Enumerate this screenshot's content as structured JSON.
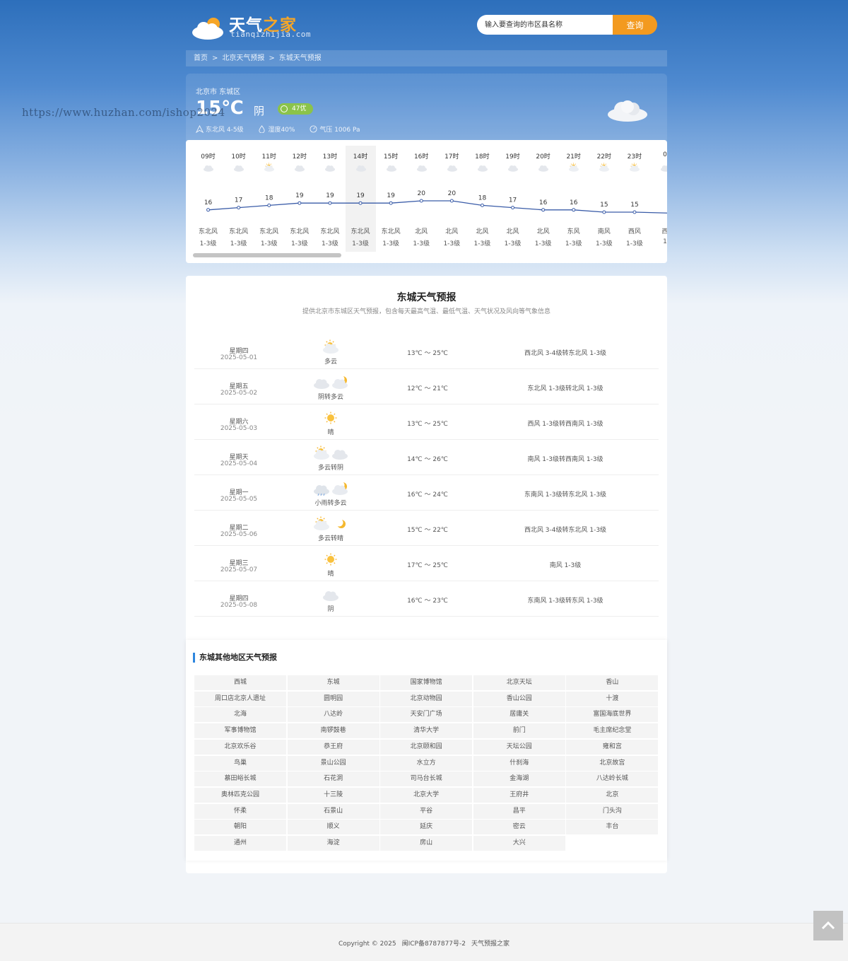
{
  "header": {
    "logo_title_a": "天气",
    "logo_title_b": "之家",
    "logo_sub": "tianqizhijia.com",
    "search_placeholder": "输入要查询的市区县名称",
    "search_button": "查询"
  },
  "breadcrumb": [
    "首页",
    "北京天气预报",
    "东城天气预报"
  ],
  "current": {
    "location": "北京市 东城区",
    "temp": "15℃",
    "desc": "阴",
    "aqi": "47优",
    "wind": "东北风 4-5级",
    "humidity": "湿度40%",
    "pressure": "气压 1006 Pa"
  },
  "watermark": "https://www.huzhan.com/ishop2024",
  "hourly": [
    {
      "time": "09时",
      "icon": "overcast",
      "temp": 16,
      "wind": "东北风",
      "level": "1-3级"
    },
    {
      "time": "10时",
      "icon": "overcast",
      "temp": 17,
      "wind": "东北风",
      "level": "1-3级"
    },
    {
      "time": "11时",
      "icon": "partly-cloudy",
      "temp": 18,
      "wind": "东北风",
      "level": "1-3级"
    },
    {
      "time": "12时",
      "icon": "overcast",
      "temp": 19,
      "wind": "东北风",
      "level": "1-3级"
    },
    {
      "time": "13时",
      "icon": "overcast",
      "temp": 19,
      "wind": "东北风",
      "level": "1-3级"
    },
    {
      "time": "14时",
      "icon": "overcast",
      "temp": 19,
      "wind": "东北风",
      "level": "1-3级"
    },
    {
      "time": "15时",
      "icon": "overcast",
      "temp": 19,
      "wind": "东北风",
      "level": "1-3级"
    },
    {
      "time": "16时",
      "icon": "overcast",
      "temp": 20,
      "wind": "北风",
      "level": "1-3级"
    },
    {
      "time": "17时",
      "icon": "overcast",
      "temp": 20,
      "wind": "北风",
      "level": "1-3级"
    },
    {
      "time": "18时",
      "icon": "overcast",
      "temp": 18,
      "wind": "北风",
      "level": "1-3级"
    },
    {
      "time": "19时",
      "icon": "overcast",
      "temp": 17,
      "wind": "北风",
      "level": "1-3级"
    },
    {
      "time": "20时",
      "icon": "overcast",
      "temp": 16,
      "wind": "北风",
      "level": "1-3级"
    },
    {
      "time": "21时",
      "icon": "partly-cloudy",
      "temp": 16,
      "wind": "东风",
      "level": "1-3级"
    },
    {
      "time": "22时",
      "icon": "partly-cloudy",
      "temp": 15,
      "wind": "南风",
      "level": "1-3级"
    },
    {
      "time": "23时",
      "icon": "partly-cloudy",
      "temp": 15,
      "wind": "西风",
      "level": "1-3级"
    },
    {
      "time": "0",
      "icon": "overcast",
      "temp": 15,
      "wind": "西",
      "level": "1"
    }
  ],
  "forecast": {
    "title": "东城天气预报",
    "subtitle": "提供北京市东城区天气预报，包含每天最高气温、最低气温、天气状况及风向等气象信息",
    "days": [
      {
        "day": "星期四",
        "date": "2025-05-01",
        "icons": [
          "partly-cloudy"
        ],
        "cond": "多云",
        "temp": "13℃ ～ 25℃",
        "wind": "西北风 3-4级转东北风 1-3级"
      },
      {
        "day": "星期五",
        "date": "2025-05-02",
        "icons": [
          "overcast",
          "cloudy-night"
        ],
        "cond": "阴转多云",
        "temp": "12℃ ～ 21℃",
        "wind": "东北风 1-3级转北风 1-3级"
      },
      {
        "day": "星期六",
        "date": "2025-05-03",
        "icons": [
          "sunny"
        ],
        "cond": "晴",
        "temp": "13℃ ～ 25℃",
        "wind": "西风 1-3级转西南风 1-3级"
      },
      {
        "day": "星期天",
        "date": "2025-05-04",
        "icons": [
          "partly-cloudy",
          "overcast"
        ],
        "cond": "多云转阴",
        "temp": "14℃ ～ 26℃",
        "wind": "南风 1-3级转西南风 1-3级"
      },
      {
        "day": "星期一",
        "date": "2025-05-05",
        "icons": [
          "light-rain",
          "cloudy-night"
        ],
        "cond": "小雨转多云",
        "temp": "16℃ ～ 24℃",
        "wind": "东南风 1-3级转东北风 1-3级"
      },
      {
        "day": "星期二",
        "date": "2025-05-06",
        "icons": [
          "partly-cloudy",
          "moon"
        ],
        "cond": "多云转晴",
        "temp": "15℃ ～ 22℃",
        "wind": "西北风 3-4级转东北风 1-3级"
      },
      {
        "day": "星期三",
        "date": "2025-05-07",
        "icons": [
          "sunny"
        ],
        "cond": "晴",
        "temp": "17℃ ～ 25℃",
        "wind": "南风 1-3级"
      },
      {
        "day": "星期四",
        "date": "2025-05-08",
        "icons": [
          "overcast"
        ],
        "cond": "阴",
        "temp": "16℃ ～ 23℃",
        "wind": "东南风 1-3级转东风 1-3级"
      }
    ]
  },
  "areas": {
    "title": "东城其他地区天气预报",
    "items": [
      "西城",
      "东城",
      "国家博物馆",
      "北京天坛",
      "香山",
      "周口店北京人遗址",
      "圆明园",
      "北京动物园",
      "香山公园",
      "十渡",
      "北海",
      "八达岭",
      "天安门广场",
      "居庸关",
      "富国海底世界",
      "军事博物馆",
      "南锣鼓巷",
      "清华大学",
      "前门",
      "毛主席纪念堂",
      "北京欢乐谷",
      "恭王府",
      "北京颐和园",
      "天坛公园",
      "雍和宫",
      "鸟巢",
      "景山公园",
      "水立方",
      "什刹海",
      "北京故宫",
      "慕田峪长城",
      "石花洞",
      "司马台长城",
      "金海湖",
      "八达岭长城",
      "奥林匹克公园",
      "十三陵",
      "北京大学",
      "王府井",
      "北京",
      "怀柔",
      "石景山",
      "平谷",
      "昌平",
      "门头沟",
      "朝阳",
      "顺义",
      "延庆",
      "密云",
      "丰台",
      "通州",
      "海淀",
      "房山",
      "大兴"
    ]
  },
  "footer": {
    "copyright": "Copyright © 2025",
    "icp": "闽ICP备8787877号-2",
    "site": "天气预报之家"
  },
  "colors": {
    "accent": "#f39a1f",
    "line": "#3a5ca8",
    "aqi": "#8bc34a",
    "title_bar": "#2e86de"
  }
}
